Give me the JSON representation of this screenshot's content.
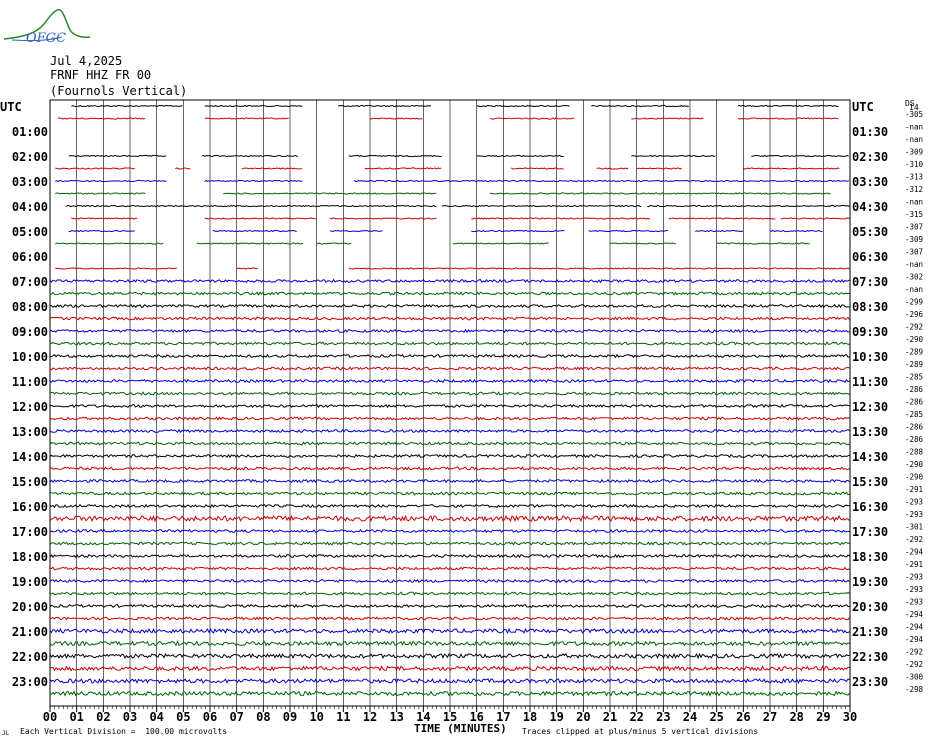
{
  "header": {
    "date": "Jul 4,2025",
    "station": "FRNF HHZ FR 00",
    "location": "(Fournols Vertical)",
    "logo_text": "OFGC"
  },
  "axis": {
    "utc_left": "UTC",
    "utc_right": "UTC",
    "ds_label": "DS",
    "ds_top": "14",
    "xlabel": "TIME (MINUTES)",
    "x_ticks": [
      "00",
      "01",
      "02",
      "03",
      "04",
      "05",
      "06",
      "07",
      "08",
      "09",
      "10",
      "11",
      "12",
      "13",
      "14",
      "15",
      "16",
      "17",
      "18",
      "19",
      "20",
      "21",
      "22",
      "23",
      "24",
      "25",
      "26",
      "27",
      "28",
      "29",
      "30"
    ]
  },
  "footer": {
    "left": "Each Vertical Division =  100.00 microvolts",
    "right": "Traces clipped at plus/minus 5 vertical divisions"
  },
  "colors": {
    "black": "#000000",
    "red": "#cc0000",
    "blue": "#0000cc",
    "green": "#006600",
    "grid": "#000000"
  },
  "chart_data": {
    "type": "line",
    "title": "FRNF HHZ FR 00",
    "xlabel": "TIME (MINUTES)",
    "xlim": [
      0,
      30
    ],
    "rows": 48,
    "left_hour_labels": [
      "UTC",
      "01:00",
      "02:00",
      "03:00",
      "04:00",
      "05:00",
      "06:00",
      "07:00",
      "08:00",
      "09:00",
      "10:00",
      "11:00",
      "12:00",
      "13:00",
      "14:00",
      "15:00",
      "16:00",
      "17:00",
      "18:00",
      "19:00",
      "20:00",
      "21:00",
      "22:00",
      "23:00"
    ],
    "right_hour_labels": [
      "UTC",
      "01:30",
      "02:30",
      "03:30",
      "04:30",
      "05:30",
      "06:30",
      "07:30",
      "08:30",
      "09:30",
      "10:30",
      "11:30",
      "12:30",
      "13:30",
      "14:30",
      "15:30",
      "16:30",
      "17:30",
      "18:30",
      "19:30",
      "20:30",
      "21:30",
      "22:30",
      "23:30"
    ],
    "ds_values": [
      "-305",
      "-nan",
      "-nan",
      "-309",
      "-310",
      "-313",
      "-312",
      "-nan",
      "-315",
      "-307",
      "-309",
      "-307",
      "-nan",
      "-302",
      "-nan",
      "-299",
      "-296",
      "-292",
      "-290",
      "-289",
      "-289",
      "-285",
      "-286",
      "-286",
      "-285",
      "-286",
      "-286",
      "-288",
      "-290",
      "-290",
      "-291",
      "-293",
      "-293",
      "-301",
      "-292",
      "-294",
      "-291",
      "-293",
      "-293",
      "-293",
      "-294",
      "-294",
      "-294",
      "-292",
      "-292",
      "-300",
      "-298"
    ],
    "trace_colors": [
      "black",
      "red",
      "blue",
      "green"
    ],
    "gap_segments_minutes": [
      [
        [
          0.8,
          5
        ],
        [
          5.8,
          9.5
        ],
        [
          10.8,
          14.3
        ],
        [
          16,
          19.5
        ],
        [
          20.3,
          24
        ],
        [
          25.8,
          29.6
        ]
      ],
      [
        [
          0.3,
          3.6
        ],
        [
          5.8,
          9
        ],
        [
          12,
          14
        ],
        [
          16.5,
          19.7
        ],
        [
          21.8,
          24.5
        ],
        [
          25.8,
          29.6
        ]
      ],
      [],
      [],
      [
        [
          0.7,
          4.4
        ],
        [
          5.7,
          9.3
        ],
        [
          11.2,
          14.7
        ],
        [
          16,
          19.3
        ],
        [
          21.8,
          25
        ],
        [
          26.3,
          30
        ]
      ],
      [
        [
          0.2,
          3.2
        ],
        [
          4.7,
          5.3
        ],
        [
          7.2,
          9.5
        ],
        [
          11.8,
          14.7
        ],
        [
          17.3,
          19.3
        ],
        [
          20.5,
          21.7
        ],
        [
          22,
          23.7
        ],
        [
          26,
          29.6
        ]
      ],
      [
        [
          0.2,
          4.4
        ],
        [
          5.8,
          9.5
        ],
        [
          11.4,
          30
        ]
      ],
      [
        [
          0.2,
          3.6
        ],
        [
          6.5,
          14.5
        ],
        [
          16.5,
          29.3
        ]
      ],
      [
        [
          0.6,
          14.5
        ],
        [
          14.7,
          22.2
        ],
        [
          22.4,
          30
        ]
      ],
      [
        [
          0.8,
          3.3
        ],
        [
          5.8,
          10
        ],
        [
          10.5,
          14.5
        ],
        [
          15.8,
          22.5
        ],
        [
          23.2,
          27.2
        ],
        [
          27.4,
          30
        ]
      ],
      [
        [
          0.7,
          3.2
        ],
        [
          6.1,
          9.3
        ],
        [
          10.5,
          12.5
        ],
        [
          15.8,
          19.3
        ],
        [
          20.2,
          23.2
        ],
        [
          24.2,
          26
        ],
        [
          27,
          29
        ]
      ],
      [
        [
          0.2,
          4.3
        ],
        [
          5.5,
          9.5
        ],
        [
          10,
          11.3
        ],
        [
          15.1,
          18.7
        ],
        [
          21,
          23.5
        ],
        [
          25,
          28.5
        ]
      ],
      [],
      [
        [
          0.2,
          4.8
        ],
        [
          7,
          7.8
        ],
        [
          11.2,
          30
        ]
      ]
    ]
  }
}
